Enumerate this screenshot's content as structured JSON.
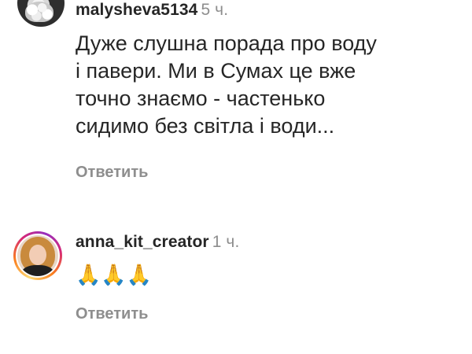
{
  "comments": [
    {
      "username": "malysheva5134",
      "time": "5 ч.",
      "text": "Дуже слушна порада про воду\nі павери. Ми в Сумах це вже\nточно знаємо - частенько\nсидимо без світла і води...",
      "reply_label": "Ответить"
    },
    {
      "username": "anna_kit_creator",
      "time": "1 ч.",
      "text": "🙏🙏🙏",
      "reply_label": "Ответить"
    }
  ],
  "colors": {
    "text": "#262626",
    "secondary": "#8e8e8e",
    "background": "#ffffff"
  }
}
